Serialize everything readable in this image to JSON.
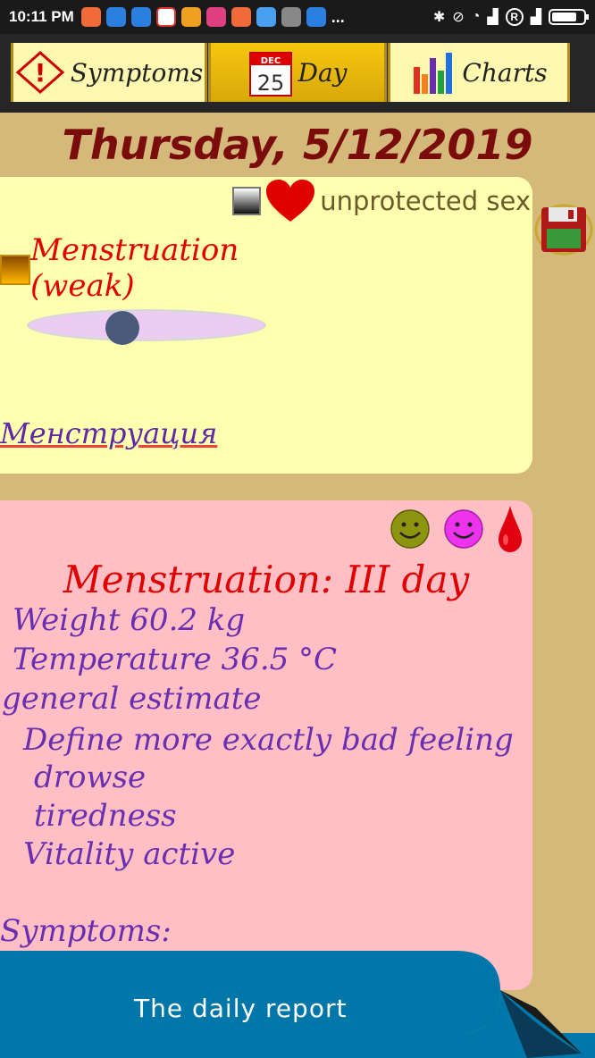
{
  "status_bar": {
    "time": "10:11 PM",
    "more": "...",
    "signal_label": "R"
  },
  "tabs": [
    {
      "label": "Symptoms",
      "icon": "warning-icon"
    },
    {
      "label": "Day",
      "icon": "calendar-icon",
      "calendar_month": "DEC",
      "calendar_day": "25"
    },
    {
      "label": "Charts",
      "icon": "bar-chart-icon"
    }
  ],
  "date_heading": "Thursday, 5/12/2019",
  "card_entry": {
    "unprotected_sex_label": "unprotected sex",
    "menstruation_label": "Menstruation (weak)",
    "intensity_level": 0.2,
    "link_text": "Менструация"
  },
  "daily_report": {
    "title": "Menstruation: III day",
    "lines": [
      "Weight 60.2 kg",
      "Temperature 36.5 °C",
      "general estimate",
      "Define more exactly bad feeling",
      "drowse",
      "tiredness",
      "Vitality active",
      "Symptoms:"
    ]
  },
  "bottom_button": {
    "label": "The daily  report"
  },
  "colors": {
    "accent_red": "#e00000",
    "report_text": "#6a2fb0",
    "card_yellow": "#ffffb0",
    "card_pink": "#ffbfc4",
    "button_blue": "#0077a8"
  }
}
